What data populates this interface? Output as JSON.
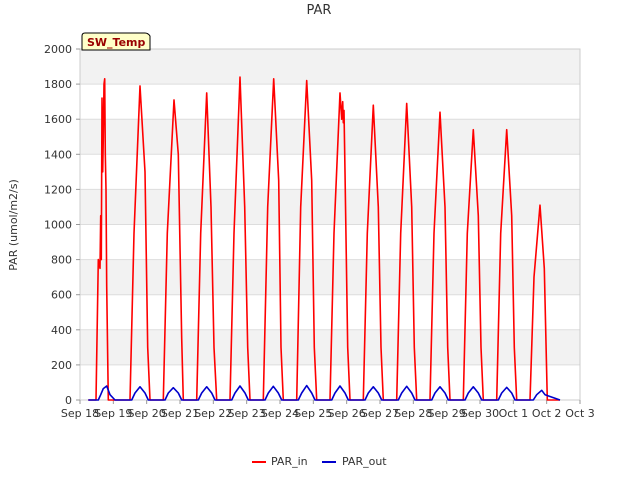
{
  "chart_data": {
    "type": "line",
    "title": "PAR",
    "ylabel": "PAR (umol/m2/s)",
    "xlabel": "",
    "badge": "SW_Temp",
    "xlim": [
      0,
      15
    ],
    "ylim": [
      0,
      2000
    ],
    "yticks": [
      0,
      200,
      400,
      600,
      800,
      1000,
      1200,
      1400,
      1600,
      1800,
      2000
    ],
    "xticks": [
      "Sep 18",
      "Sep 19",
      "Sep 20",
      "Sep 21",
      "Sep 22",
      "Sep 23",
      "Sep 24",
      "Sep 25",
      "Sep 26",
      "Sep 27",
      "Sep 28",
      "Sep 29",
      "Sep 30",
      "Oct 1",
      "Oct 2",
      "Oct 3"
    ],
    "grid": true,
    "legend_position": "bottom-center",
    "series": [
      {
        "name": "PAR_in",
        "color": "#ff0000",
        "x": [
          0.25,
          0.48,
          0.55,
          0.6,
          0.62,
          0.64,
          0.66,
          0.68,
          0.7,
          0.72,
          0.74,
          0.76,
          0.78,
          0.8,
          0.85,
          0.9,
          0.98,
          1.05,
          1.5,
          1.62,
          1.8,
          1.95,
          2.03,
          2.1,
          2.5,
          2.62,
          2.82,
          2.95,
          3.05,
          3.1,
          3.5,
          3.62,
          3.8,
          3.93,
          4.02,
          4.1,
          4.5,
          4.62,
          4.8,
          4.94,
          5.03,
          5.1,
          5.5,
          5.63,
          5.81,
          5.96,
          6.03,
          6.1,
          6.5,
          6.62,
          6.8,
          6.95,
          7.03,
          7.1,
          7.5,
          7.62,
          7.8,
          7.85,
          7.88,
          7.9,
          7.92,
          7.95,
          8.03,
          8.1,
          8.5,
          8.62,
          8.8,
          8.95,
          9.03,
          9.1,
          9.5,
          9.62,
          9.8,
          9.95,
          10.03,
          10.1,
          10.5,
          10.62,
          10.8,
          10.95,
          11.03,
          11.1,
          11.5,
          11.62,
          11.8,
          11.95,
          12.03,
          12.1,
          12.5,
          12.62,
          12.8,
          12.95,
          13.03,
          13.1,
          13.5,
          13.62,
          13.8,
          13.93,
          14.02,
          14.1,
          14.4
        ],
        "y": [
          0,
          0,
          800,
          750,
          1050,
          800,
          1720,
          1300,
          1500,
          1800,
          1830,
          1400,
          1200,
          650,
          0,
          0,
          0,
          0,
          0,
          950,
          1790,
          1300,
          300,
          0,
          0,
          950,
          1710,
          1400,
          350,
          0,
          0,
          950,
          1750,
          1100,
          300,
          0,
          0,
          950,
          1840,
          1100,
          300,
          0,
          0,
          1100,
          1830,
          1250,
          300,
          0,
          0,
          1100,
          1820,
          1250,
          300,
          0,
          0,
          950,
          1750,
          1600,
          1700,
          1580,
          1650,
          1300,
          300,
          0,
          0,
          950,
          1680,
          1100,
          300,
          0,
          0,
          950,
          1690,
          1100,
          300,
          0,
          0,
          950,
          1640,
          1100,
          300,
          0,
          0,
          950,
          1540,
          1050,
          300,
          0,
          0,
          950,
          1540,
          1050,
          300,
          0,
          0,
          700,
          1110,
          750,
          0,
          0,
          0
        ]
      },
      {
        "name": "PAR_out",
        "color": "#0000cc",
        "x": [
          0.25,
          0.55,
          0.62,
          0.7,
          0.8,
          0.9,
          1.05,
          1.55,
          1.65,
          1.8,
          1.95,
          2.05,
          2.55,
          2.65,
          2.8,
          2.95,
          3.05,
          3.55,
          3.65,
          3.8,
          3.95,
          4.05,
          4.55,
          4.65,
          4.8,
          4.95,
          5.05,
          5.55,
          5.65,
          5.8,
          5.95,
          6.05,
          6.55,
          6.65,
          6.8,
          6.95,
          7.05,
          7.55,
          7.65,
          7.8,
          7.95,
          8.05,
          8.55,
          8.65,
          8.8,
          8.95,
          9.05,
          9.55,
          9.65,
          9.8,
          9.95,
          10.05,
          10.55,
          10.65,
          10.8,
          10.95,
          11.05,
          11.55,
          11.65,
          11.8,
          11.95,
          12.05,
          12.55,
          12.65,
          12.8,
          12.95,
          13.05,
          13.6,
          13.7,
          13.85,
          13.95,
          14.4
        ],
        "y": [
          0,
          0,
          30,
          65,
          80,
          30,
          0,
          0,
          40,
          75,
          40,
          0,
          0,
          40,
          70,
          40,
          0,
          0,
          40,
          75,
          40,
          0,
          0,
          40,
          80,
          40,
          0,
          0,
          40,
          78,
          40,
          0,
          0,
          40,
          82,
          40,
          0,
          0,
          40,
          80,
          40,
          0,
          0,
          40,
          75,
          40,
          0,
          0,
          40,
          78,
          40,
          0,
          0,
          40,
          75,
          40,
          0,
          0,
          40,
          75,
          40,
          0,
          0,
          40,
          72,
          40,
          0,
          0,
          30,
          55,
          30,
          0
        ]
      }
    ]
  }
}
